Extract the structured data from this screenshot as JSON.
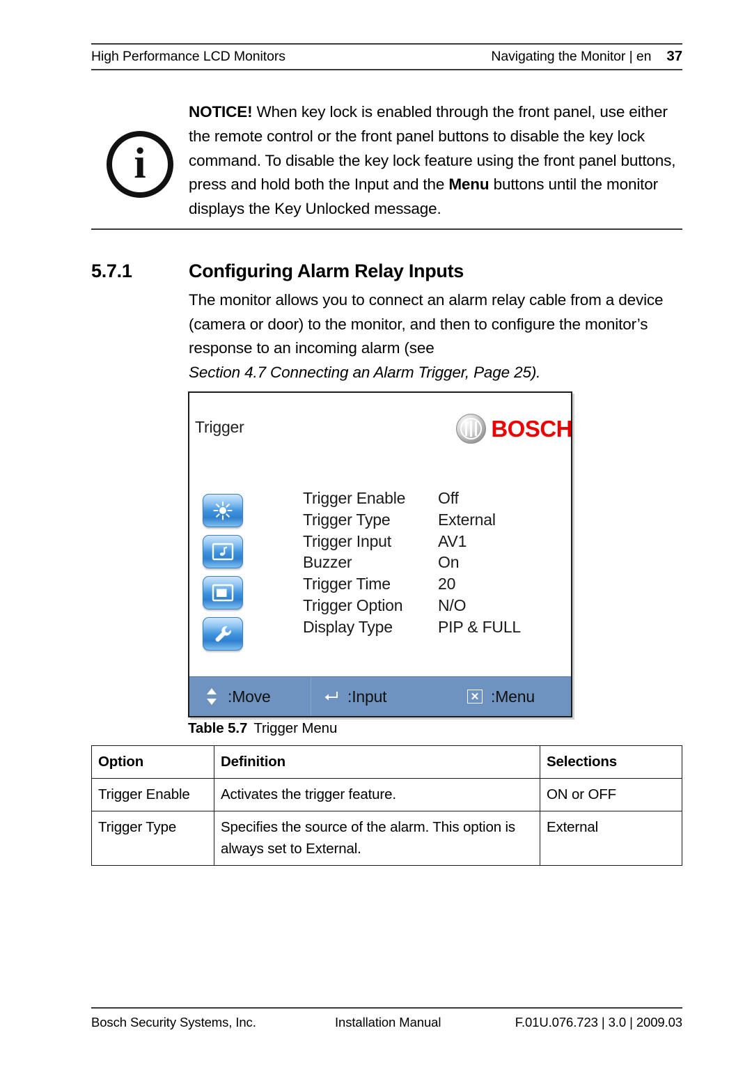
{
  "header": {
    "left": "High Performance LCD Monitors",
    "right": "Navigating the Monitor | en",
    "page_number": "37"
  },
  "notice": {
    "icon": "info-icon",
    "label": "NOTICE!",
    "text_part1": " When key lock is enabled through the front panel, use either the remote control or the front panel buttons to disable the key lock command. To disable the key lock feature using the front panel buttons, press and hold both the Input and the ",
    "bold_word": "Menu",
    "text_part2": " buttons until the monitor displays the Key Unlocked message."
  },
  "section": {
    "number": "5.7.1",
    "title": "Configuring Alarm Relay Inputs",
    "body": "The monitor allows you to connect an alarm relay cable from a device (camera or door) to the monitor, and then to configure the monitor’s response to an incoming alarm (see ",
    "cross_reference": "Section 4.7 Connecting an Alarm Trigger, Page 25)."
  },
  "osd": {
    "title": "Trigger",
    "brand": "BOSCH",
    "brand_color": "#ee0000",
    "statusbar_color": "#6e93c0",
    "sidebar_icons": [
      {
        "name": "brightness-icon"
      },
      {
        "name": "audio-icon"
      },
      {
        "name": "pip-display-icon"
      },
      {
        "name": "settings-wrench-icon"
      }
    ],
    "rows": [
      {
        "label": "Trigger Enable",
        "value": "Off"
      },
      {
        "label": "Trigger Type",
        "value": "External"
      },
      {
        "label": "Trigger Input",
        "value": "AV1"
      },
      {
        "label": "Buzzer",
        "value": "On"
      },
      {
        "label": "Trigger Time",
        "value": "20"
      },
      {
        "label": "Trigger Option",
        "value": "N/O"
      },
      {
        "label": "Display Type",
        "value": "PIP & FULL"
      }
    ],
    "statusbar": [
      {
        "icon": "up-down-arrow-icon",
        "label": ":Move"
      },
      {
        "icon": "enter-return-icon",
        "label": ":Input"
      },
      {
        "icon": "close-x-icon",
        "label": ":Menu"
      }
    ]
  },
  "table": {
    "caption_label": "Table 5.7",
    "caption_text": "Trigger Menu",
    "columns": [
      "Option",
      "Definition",
      "Selections"
    ],
    "rows": [
      {
        "option": "Trigger Enable",
        "definition": "Activates the trigger feature.",
        "selections": "ON or OFF"
      },
      {
        "option": "Trigger Type",
        "definition": "Specifies the source of the alarm. This option is always set to External.",
        "selections": "External"
      }
    ]
  },
  "footer": {
    "left": "Bosch Security Systems, Inc.",
    "middle": "Installation Manual",
    "right": "F.01U.076.723 | 3.0 | 2009.03"
  }
}
